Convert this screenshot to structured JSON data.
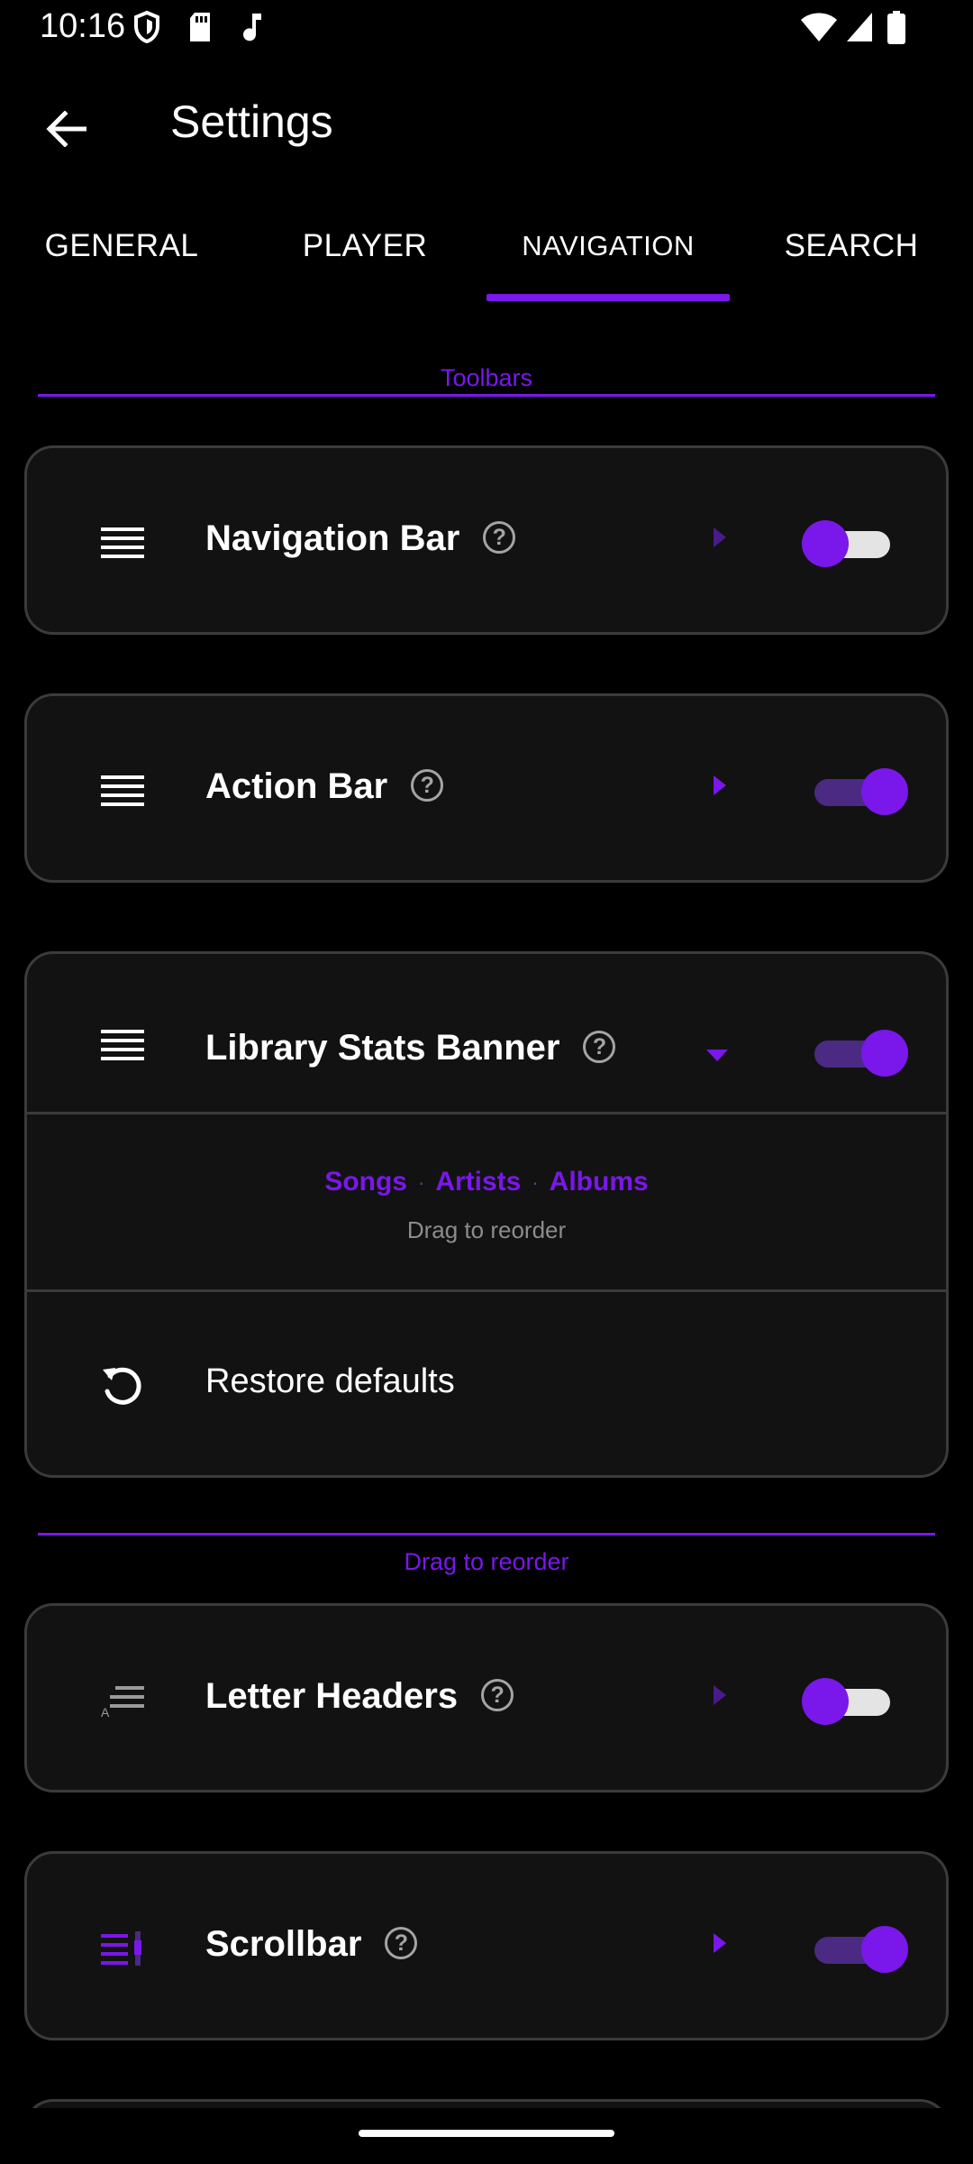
{
  "status_bar": {
    "time": "10:16"
  },
  "app_bar": {
    "title": "Settings"
  },
  "tabs": [
    {
      "label": "GENERAL",
      "selected": false
    },
    {
      "label": "PLAYER",
      "selected": false
    },
    {
      "label": "NAVIGATION",
      "selected": true
    },
    {
      "label": "SEARCH",
      "selected": false
    }
  ],
  "toolbars_section": {
    "header": "Toolbars",
    "items": [
      {
        "label": "Navigation Bar",
        "help_icon": "help-circle-icon",
        "icon": "drag-handle-icon",
        "enabled": false,
        "expanded": false
      },
      {
        "label": "Action Bar",
        "help_icon": "help-circle-icon",
        "icon": "drag-handle-icon",
        "enabled": true,
        "expanded": false
      },
      {
        "label": "Library Stats Banner",
        "help_icon": "help-circle-icon",
        "icon": "drag-handle-icon",
        "enabled": true,
        "expanded": true,
        "order_items": [
          "Songs",
          "Artists",
          "Albums"
        ],
        "separator": "·",
        "order_hint": "Drag to reorder",
        "restore_label": "Restore defaults",
        "restore_icon": "restore-icon"
      }
    ]
  },
  "list_section": {
    "hint": "Drag to reorder",
    "items": [
      {
        "label": "Letter Headers",
        "help_icon": "help-circle-icon",
        "icon": "letter-headers-icon",
        "enabled": false,
        "expanded": false
      },
      {
        "label": "Scrollbar",
        "help_icon": "help-circle-icon",
        "icon": "scrollbar-icon",
        "enabled": true,
        "expanded": false
      }
    ]
  },
  "colors": {
    "accent": "#7a17ea",
    "background": "#000000",
    "card": "#121212",
    "card_border": "#3b3b3b"
  }
}
